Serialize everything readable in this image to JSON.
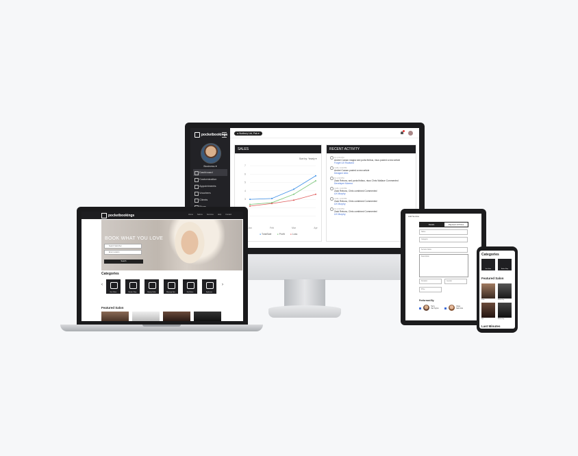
{
  "desktop": {
    "logo": "pocketbookings",
    "business": "Business",
    "nav": [
      "Dashboard",
      "Customization",
      "Appointments",
      "Vouchers",
      "Clients",
      "Blogs"
    ],
    "location_pill": "Sudbury Ltd, Pak",
    "sales": {
      "title": "SALES",
      "sort_label": "Sort by:",
      "sort_value": "Yearly",
      "legend": [
        "TotalSale",
        "Profit",
        "Loss"
      ]
    },
    "activity": {
      "title": "RECENT ACTIVITY",
      "items": [
        {
          "time": "Fri 2:00 PM",
          "text": "Andrei Coman magna sed porta finibus, risus posted a new article",
          "link": "Forget UX Rowland"
        },
        {
          "time": "4 AM, 4:00 PM",
          "text": "Andrei Coman posted a new article",
          "link": "Designer Alex"
        },
        {
          "time": "Fri 2:00 PM",
          "text": "Zack Rebora, sed porta finibus, risus Chris Wallace Commented",
          "link": "Developer Moreno"
        },
        {
          "time": "4 AM, 4:00 PM",
          "text": "Zack Rebora, Chris combined Commented",
          "link": "UX Murphy"
        },
        {
          "time": "4 AM, 4:00 PM",
          "text": "Zack Rebora, Chris combined Commented",
          "link": "UX Murphy"
        },
        {
          "time": "Fri 2:00 PM",
          "text": "Zack Rebora, Chris combined Commented",
          "link": "UX Murphy"
        }
      ]
    }
  },
  "chart_data": {
    "type": "line",
    "categories": [
      "Jan",
      "Feb",
      "Mar",
      "Apr"
    ],
    "series": [
      {
        "name": "TotalSale",
        "values": [
          3.0,
          3.1,
          4.2,
          5.8
        ]
      },
      {
        "name": "Profit",
        "values": [
          2.4,
          2.6,
          3.6,
          5.2
        ]
      },
      {
        "name": "Loss",
        "values": [
          2.2,
          2.5,
          2.9,
          3.6
        ]
      }
    ],
    "ylim": [
      0,
      7
    ],
    "yticks": [
      "7",
      "6",
      "5",
      "4",
      "3",
      "2",
      "1"
    ]
  },
  "laptop": {
    "logo": "pocketbookings",
    "links": [
      "Home",
      "Salons",
      "Services",
      "Help",
      "Contact"
    ],
    "hero_title": "BOOK WHAT YOU LOVE",
    "search_placeholder": "Search Salon/Ser",
    "location_placeholder": "Enter Location",
    "search_button": "Search",
    "categories_title": "Categories",
    "categories": [
      "Hair Salon",
      "Barber Shop",
      "Beauty Salon",
      "Massage Spa",
      "Nail Salon",
      "Eyebrows"
    ],
    "featured_title": "Featured Salon"
  },
  "tablet": {
    "title": "Add Service",
    "tabs": [
      "Details",
      "Payment & Prices"
    ],
    "fields": [
      "Name",
      "Category",
      "Service Name"
    ],
    "description": "Description",
    "duration": "Duration",
    "gender": "Gender",
    "price": "Price",
    "performed_by": "Performed By",
    "staff": [
      {
        "name": "Harry",
        "role": "Hair Stylist"
      },
      {
        "name": "Olivia",
        "role": "Nail Artist"
      }
    ]
  },
  "phone": {
    "categories_title": "Categories",
    "categories": [
      "Hair Salon",
      "Barber Shop"
    ],
    "featured_title": "Featured Salon",
    "last_title": "Last Minutes",
    "salons": [
      "Salon",
      "Barbershop",
      "Spa",
      "Barbershop"
    ]
  }
}
